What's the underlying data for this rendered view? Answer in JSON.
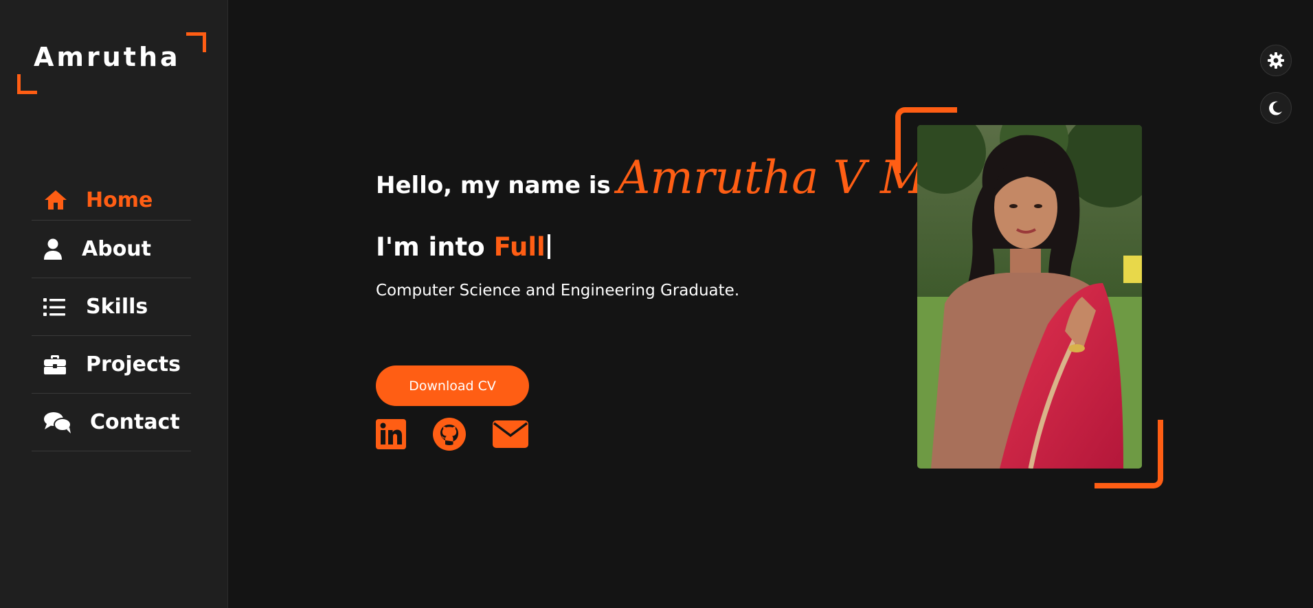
{
  "logo": {
    "text": "Amrutha"
  },
  "nav": {
    "items": [
      {
        "label": "Home",
        "icon": "home-icon",
        "active": true
      },
      {
        "label": "About",
        "icon": "user-icon",
        "active": false
      },
      {
        "label": "Skills",
        "icon": "list-icon",
        "active": false
      },
      {
        "label": "Projects",
        "icon": "briefcase-icon",
        "active": false
      },
      {
        "label": "Contact",
        "icon": "chat-icon",
        "active": false
      }
    ]
  },
  "hero": {
    "greeting": "Hello, my name is",
    "name": "Amrutha V M",
    "role_prefix": "I'm into",
    "role_typed": "Full",
    "description": "Computer Science and Engineering Graduate.",
    "cv_button": "Download CV",
    "socials": [
      {
        "name": "linkedin-icon"
      },
      {
        "name": "github-icon"
      },
      {
        "name": "mail-icon"
      }
    ]
  },
  "controls": {
    "settings": "gear-icon",
    "theme": "moon-icon"
  },
  "colors": {
    "accent": "#ff5e14",
    "background": "#141414",
    "sidebar": "#1f1f1f",
    "text": "#ffffff"
  }
}
